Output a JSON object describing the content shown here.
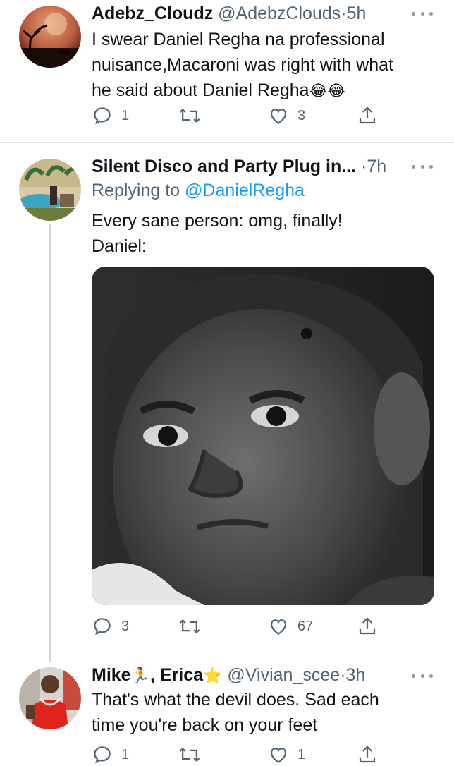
{
  "tweets": [
    {
      "name": "Adebz_Cloudz",
      "handle": "@AdebzClouds",
      "dot": "·",
      "time": "5h",
      "text_line1": "I swear Daniel Regha na professional",
      "text_line2": "nuisance,Macaroni was right with what",
      "text_line3": "he said about Daniel Regha",
      "emojis": "😂😂",
      "replies": "1",
      "likes": "3"
    },
    {
      "name": "Silent Disco and Party Plug in...",
      "dot": "·",
      "time": "7h",
      "replying_label": "Replying to ",
      "replying_mention": "@DanielRegha",
      "text_line1": "Every sane person: omg, finally!",
      "text_line2": "Daniel:",
      "replies": "3",
      "likes": "67"
    },
    {
      "name_part1": "Mike",
      "name_emoji1": "🏃",
      "name_part2": ", Erica",
      "name_emoji2": "⭐",
      "handle": "@Vivian_scee",
      "dot": "·",
      "time": "3h",
      "text_line1": "That's what the devil does. Sad each",
      "text_line2": "time you're back on your feet",
      "replies": "1",
      "likes": "1"
    }
  ],
  "icons": {
    "reply": "reply-icon",
    "retweet": "retweet-icon",
    "like": "like-icon",
    "share": "share-icon",
    "more": "more-icon"
  },
  "colors": {
    "link": "#1d9bf0",
    "secondary": "#536471",
    "divider": "#e1e8ed"
  }
}
